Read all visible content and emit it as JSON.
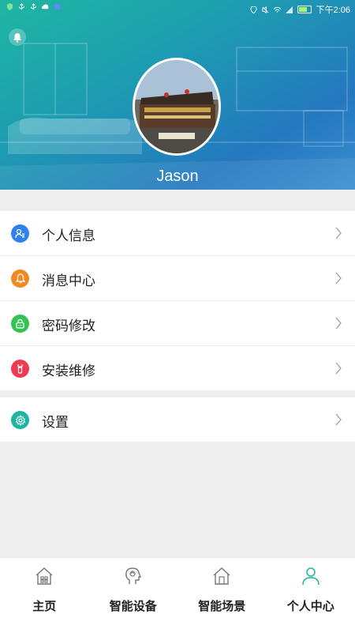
{
  "status_bar": {
    "time": "下午2:06"
  },
  "profile": {
    "username": "Jason"
  },
  "menu": {
    "items": [
      {
        "label": "个人信息",
        "icon": "user-info-icon",
        "color": "#2d82f0"
      },
      {
        "label": "消息中心",
        "icon": "bell-icon",
        "color": "#f28a23"
      },
      {
        "label": "密码修改",
        "icon": "lock-icon",
        "color": "#34c353"
      },
      {
        "label": "安装维修",
        "icon": "wrench-icon",
        "color": "#ee3b4f"
      }
    ],
    "settings": {
      "label": "设置",
      "icon": "gear-icon",
      "color": "#1fb3a0"
    }
  },
  "bottom_nav": {
    "items": [
      {
        "label": "主页",
        "icon": "home-icon"
      },
      {
        "label": "智能设备",
        "icon": "smart-device-icon"
      },
      {
        "label": "智能场景",
        "icon": "smart-scene-icon"
      },
      {
        "label": "个人中心",
        "icon": "person-icon",
        "active": true
      }
    ]
  },
  "colors": {
    "accent": "#1fb3a0",
    "header_gradient_start": "#1fb6a2",
    "header_gradient_end": "#2478bf"
  }
}
